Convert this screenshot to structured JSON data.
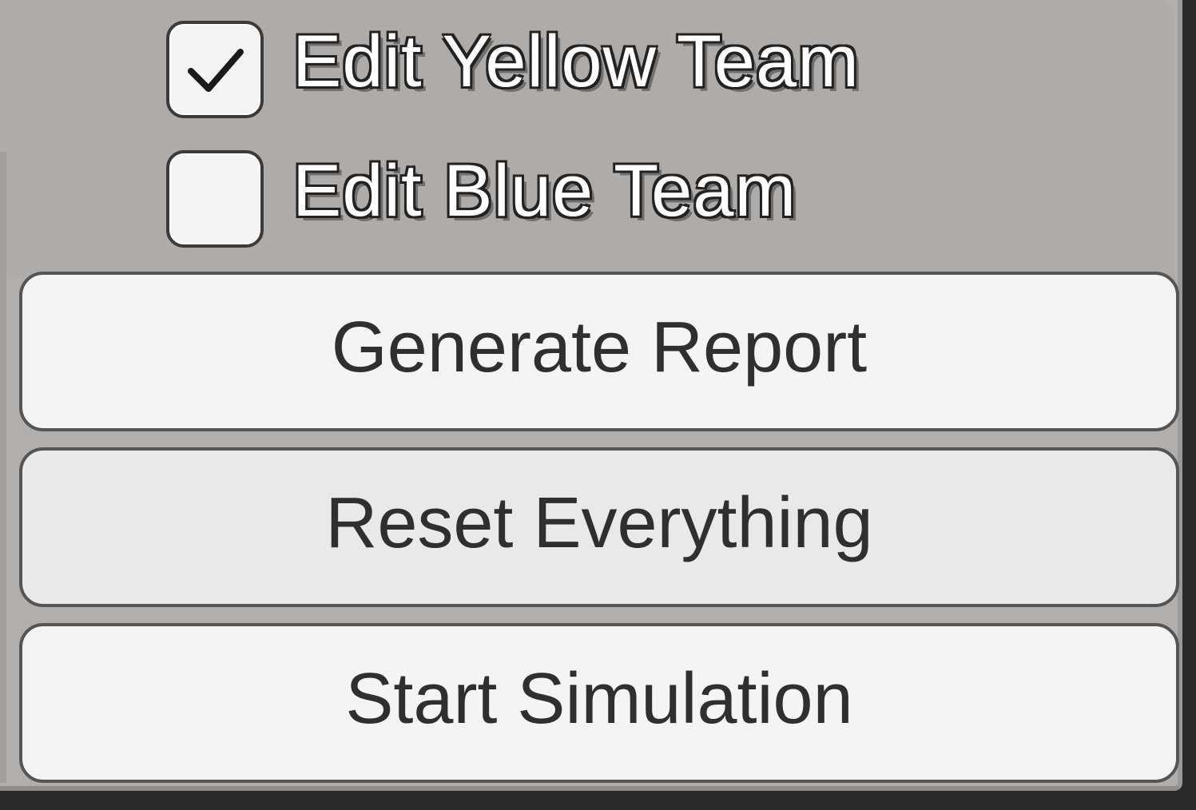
{
  "toggles": [
    {
      "label": "Edit Yellow Team",
      "checked": true
    },
    {
      "label": "Edit Blue Team",
      "checked": false
    }
  ],
  "buttons": {
    "generate_report": "Generate Report",
    "reset_everything": "Reset Everything",
    "start_simulation": "Start Simulation"
  },
  "colors": {
    "panel": "#b1aeab",
    "button_face": "#f4f4f4",
    "button_pressed": "#e9e9e9",
    "label_text": "#ffffff",
    "label_outline": "#222222"
  }
}
